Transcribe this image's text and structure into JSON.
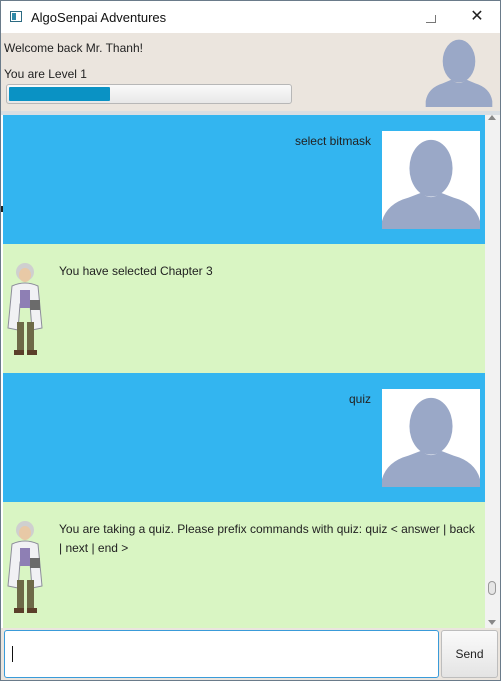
{
  "window": {
    "title": "AlgoSenpai Adventures"
  },
  "header": {
    "welcome": "Welcome back Mr. Thanh!",
    "level": "You are Level 1",
    "progress": 0.36
  },
  "messages": [
    {
      "role": "user",
      "text": "select bitmask"
    },
    {
      "role": "bot",
      "text": "You have selected Chapter 3"
    },
    {
      "role": "user",
      "text": "quiz"
    },
    {
      "role": "bot",
      "text": "You are taking a quiz. Please prefix commands with quiz: quiz    < answer | back | next | end  >"
    }
  ],
  "input": {
    "value": "",
    "placeholder": ""
  },
  "send_label": "Send",
  "colors": {
    "user_bubble": "#33b5f0",
    "bot_bubble": "#d9f5c3",
    "header_bg": "#ebe5de",
    "progress": "#0a92c4"
  }
}
